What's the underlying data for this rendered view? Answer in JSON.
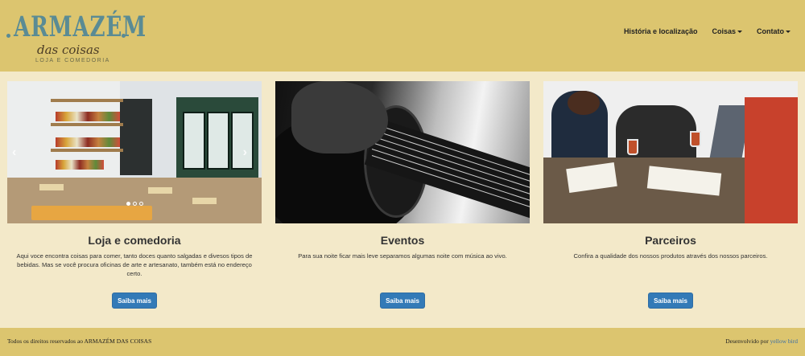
{
  "header": {
    "logo": {
      "title": "ARMAZÉM",
      "script": "das coisas",
      "tagline": "LOJA E COMEDORIA"
    },
    "nav": [
      {
        "label": "História e localização",
        "dropdown": false
      },
      {
        "label": "Coisas",
        "dropdown": true
      },
      {
        "label": "Contato",
        "dropdown": true
      }
    ]
  },
  "columns": [
    {
      "title": "Loja e comedoria",
      "text": "Aqui voce encontra coisas para comer, tanto doces quanto salgadas e divesos tipos de bebidas. Mas se você procura oficinas de arte e artesanato, também está no endereço certo.",
      "button": "Saiba mais"
    },
    {
      "title": "Eventos",
      "text": "Para sua noite ficar mais leve separamos algumas noite com música ao vivo.",
      "button": "Saiba mais"
    },
    {
      "title": "Parceiros",
      "text": "Confira a qualidade dos nossos produtos através dos nossos parceiros.",
      "button": "Saiba mais"
    }
  ],
  "carousel": {
    "left_arrow": "‹",
    "right_arrow": "›",
    "slide_count": 3,
    "active_slide": 1
  },
  "footer": {
    "copyright": "Todos os direitos reservados ao ARMAZÉM DAS COISAS",
    "dev_prefix": "Desenvolvido por",
    "dev_link": "yellow bird"
  },
  "colors": {
    "header_bg": "#dcc56f",
    "page_bg": "#f3e9c9",
    "button_bg": "#337ab7",
    "logo_teal": "#5a8b94",
    "link": "#3b6fa6"
  }
}
